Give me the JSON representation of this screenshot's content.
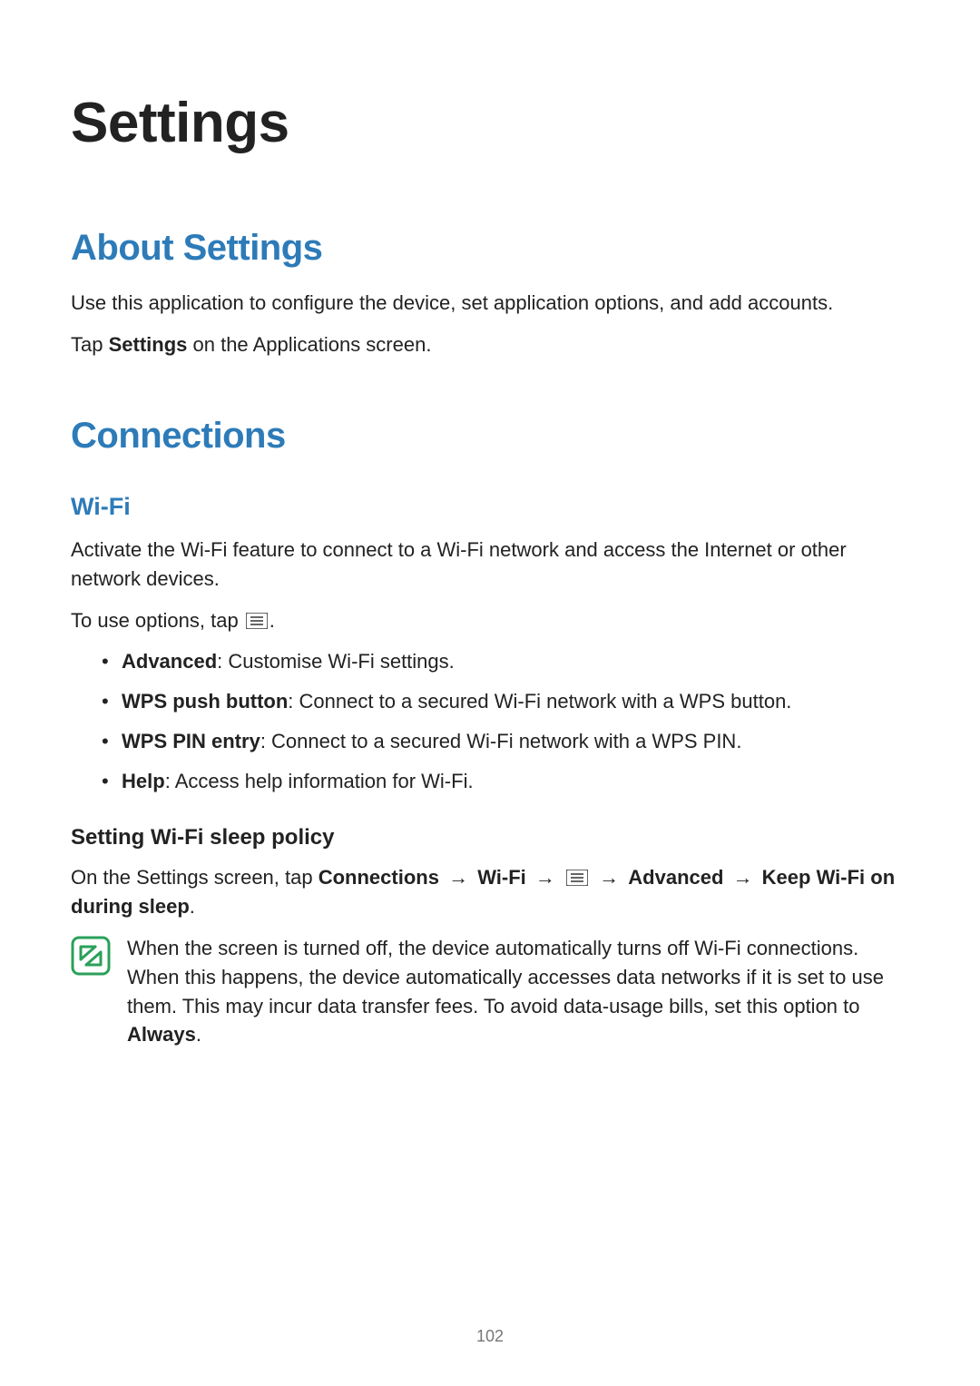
{
  "page": {
    "title": "Settings",
    "number": "102"
  },
  "sections": {
    "about": {
      "heading": "About Settings",
      "p1": "Use this application to configure the device, set application options, and add accounts.",
      "p2_pre": "Tap ",
      "p2_bold": "Settings",
      "p2_post": " on the Applications screen."
    },
    "connections": {
      "heading": "Connections",
      "wifi": {
        "heading": "Wi-Fi",
        "p1": "Activate the Wi-Fi feature to connect to a Wi-Fi network and access the Internet or other network devices.",
        "p2_pre": "To use options, tap ",
        "p2_post": ".",
        "options": [
          {
            "bold": "Advanced",
            "rest": ": Customise Wi-Fi settings."
          },
          {
            "bold": "WPS push button",
            "rest": ": Connect to a secured Wi-Fi network with a WPS button."
          },
          {
            "bold": "WPS PIN entry",
            "rest": ": Connect to a secured Wi-Fi network with a WPS PIN."
          },
          {
            "bold": "Help",
            "rest": ": Access help information for Wi-Fi."
          }
        ],
        "sleep": {
          "heading": "Setting Wi-Fi sleep policy",
          "p1_pre": "On the Settings screen, tap ",
          "path_connections": "Connections",
          "path_wifi": "Wi-Fi",
          "path_advanced": "Advanced",
          "path_keep": "Keep Wi-Fi on during sleep",
          "arrow": "→",
          "period": ".",
          "note_pre": "When the screen is turned off, the device automatically turns off Wi-Fi connections. When this happens, the device automatically accesses data networks if it is set to use them. This may incur data transfer fees. To avoid data-usage bills, set this option to ",
          "note_bold": "Always",
          "note_post": "."
        }
      }
    }
  }
}
